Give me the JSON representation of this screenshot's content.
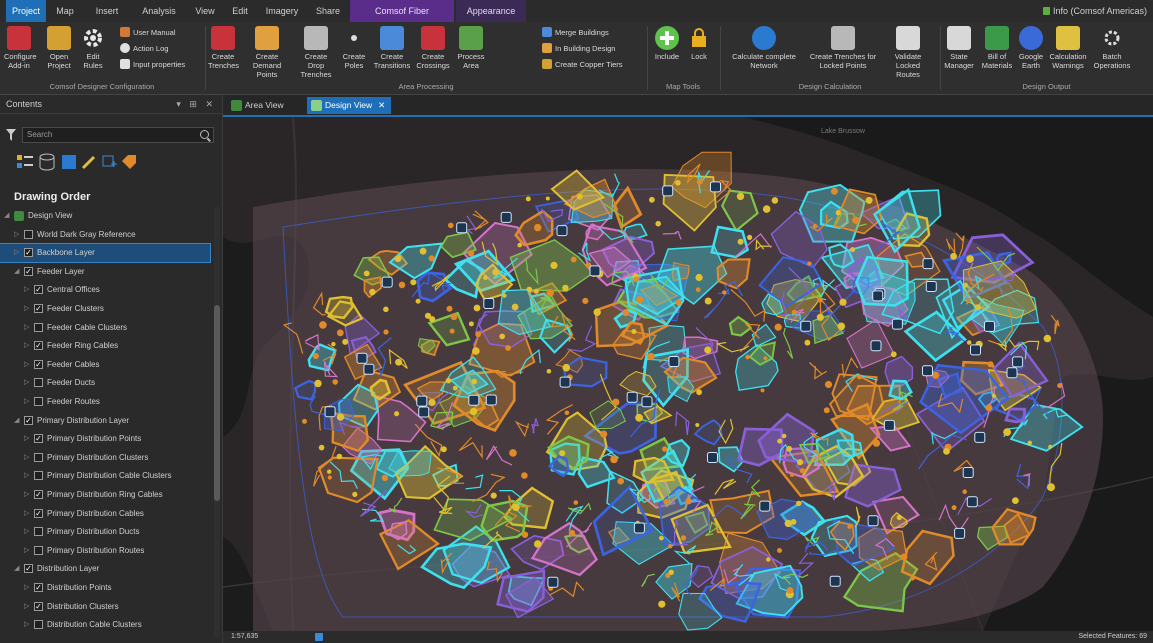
{
  "ribbon_tabs": [
    {
      "label": "Project",
      "style": "project"
    },
    {
      "label": "Map",
      "style": ""
    },
    {
      "label": "Insert",
      "style": ""
    },
    {
      "label": "Analysis",
      "style": ""
    },
    {
      "label": "View",
      "style": ""
    },
    {
      "label": "Edit",
      "style": ""
    },
    {
      "label": "Imagery",
      "style": ""
    },
    {
      "label": "Share",
      "style": ""
    },
    {
      "label": "Comsof Fiber Designer",
      "style": "ctx"
    },
    {
      "label": "Appearance",
      "style": "ctx2"
    }
  ],
  "user_label": "Info (Comsof Americas)",
  "ribbon": {
    "configure": "Configure Add-in",
    "open_project": "Open Project",
    "edit_rules": "Edit Rules",
    "user_manual": "User Manual",
    "action_log": "Action Log",
    "input_properties": "Input properties",
    "create_trenches": "Create Trenches",
    "create_demand_points": "Create Demand Points",
    "create_drop_trenches": "Create Drop Trenches",
    "create_poles": "Create Poles",
    "create_transitions": "Create Transitions",
    "create_crossings": "Create Crossings",
    "process_area": "Process Area",
    "merge_buildings": "Merge Buildings",
    "in_building_design": "In Building Design",
    "create_copper_tiers": "Create Copper Tiers",
    "include": "Include",
    "lock": "Lock",
    "calc_network": "Calculate complete Network",
    "create_trenches_locked": "Create Trenches for Locked Points",
    "validate_locked": "Validate Locked Routes",
    "state_manager": "State Manager",
    "bill_of_materials": "Bill of Materials",
    "google_earth": "Google Earth",
    "calc_warnings": "Calculation Warnings",
    "batch_ops": "Batch Operations"
  },
  "ribbon_groups": {
    "config": "Comsof Designer Configuration",
    "area": "Area Processing",
    "map_tools": "Map Tools",
    "design_calc": "Design Calculation",
    "design_output": "Design Output"
  },
  "contents": {
    "title": "Contents",
    "search_placeholder": "Search",
    "drawing_order": "Drawing Order",
    "layers": [
      {
        "label": "Design View",
        "level": 0,
        "checkbox": false,
        "checked": false,
        "expanded": true,
        "selected": false
      },
      {
        "label": "World Dark Gray Reference",
        "level": 1,
        "checkbox": true,
        "checked": false,
        "expanded": false,
        "selected": false
      },
      {
        "label": "Backbone Layer",
        "level": 1,
        "checkbox": true,
        "checked": true,
        "expanded": false,
        "selected": true
      },
      {
        "label": "Feeder Layer",
        "level": 1,
        "checkbox": true,
        "checked": true,
        "expanded": true,
        "selected": false
      },
      {
        "label": "Central Offices",
        "level": 2,
        "checkbox": true,
        "checked": true,
        "expanded": false,
        "selected": false
      },
      {
        "label": "Feeder Clusters",
        "level": 2,
        "checkbox": true,
        "checked": true,
        "expanded": false,
        "selected": false
      },
      {
        "label": "Feeder Cable Clusters",
        "level": 2,
        "checkbox": true,
        "checked": false,
        "expanded": false,
        "selected": false
      },
      {
        "label": "Feeder Ring Cables",
        "level": 2,
        "checkbox": true,
        "checked": true,
        "expanded": false,
        "selected": false
      },
      {
        "label": "Feeder Cables",
        "level": 2,
        "checkbox": true,
        "checked": true,
        "expanded": false,
        "selected": false
      },
      {
        "label": "Feeder Ducts",
        "level": 2,
        "checkbox": true,
        "checked": false,
        "expanded": false,
        "selected": false
      },
      {
        "label": "Feeder Routes",
        "level": 2,
        "checkbox": true,
        "checked": false,
        "expanded": false,
        "selected": false
      },
      {
        "label": "Primary Distribution Layer",
        "level": 1,
        "checkbox": true,
        "checked": true,
        "expanded": true,
        "selected": false
      },
      {
        "label": "Primary Distribution Points",
        "level": 2,
        "checkbox": true,
        "checked": true,
        "expanded": false,
        "selected": false
      },
      {
        "label": "Primary Distribution Clusters",
        "level": 2,
        "checkbox": true,
        "checked": false,
        "expanded": false,
        "selected": false
      },
      {
        "label": "Primary Distribution Cable Clusters",
        "level": 2,
        "checkbox": true,
        "checked": false,
        "expanded": false,
        "selected": false
      },
      {
        "label": "Primary Distribution Ring Cables",
        "level": 2,
        "checkbox": true,
        "checked": true,
        "expanded": false,
        "selected": false
      },
      {
        "label": "Primary Distribution Cables",
        "level": 2,
        "checkbox": true,
        "checked": true,
        "expanded": false,
        "selected": false
      },
      {
        "label": "Primary Distribution Ducts",
        "level": 2,
        "checkbox": true,
        "checked": false,
        "expanded": false,
        "selected": false
      },
      {
        "label": "Primary Distribution Routes",
        "level": 2,
        "checkbox": true,
        "checked": false,
        "expanded": false,
        "selected": false
      },
      {
        "label": "Distribution Layer",
        "level": 1,
        "checkbox": true,
        "checked": true,
        "expanded": true,
        "selected": false
      },
      {
        "label": "Distribution Points",
        "level": 2,
        "checkbox": true,
        "checked": true,
        "expanded": false,
        "selected": false
      },
      {
        "label": "Distribution Clusters",
        "level": 2,
        "checkbox": true,
        "checked": true,
        "expanded": false,
        "selected": false
      },
      {
        "label": "Distribution Cable Clusters",
        "level": 2,
        "checkbox": true,
        "checked": false,
        "expanded": false,
        "selected": false
      }
    ]
  },
  "view_tabs": [
    {
      "label": "Area View",
      "active": false
    },
    {
      "label": "Design View",
      "active": true
    }
  ],
  "map": {
    "place_labels": [
      "Lake Brussow"
    ],
    "colors": {
      "background": "#2a2627",
      "service_area": "#5c4a52",
      "cyan": "#3fe0ee",
      "orange": "#e08a2a",
      "blue": "#3c64e0",
      "pink": "#d473c8",
      "green": "#7ec64a",
      "yellow": "#e0c030",
      "purple": "#8a60d8"
    }
  },
  "status": {
    "scale": "1:57,635",
    "selected_features": "Selected Features: 69"
  }
}
